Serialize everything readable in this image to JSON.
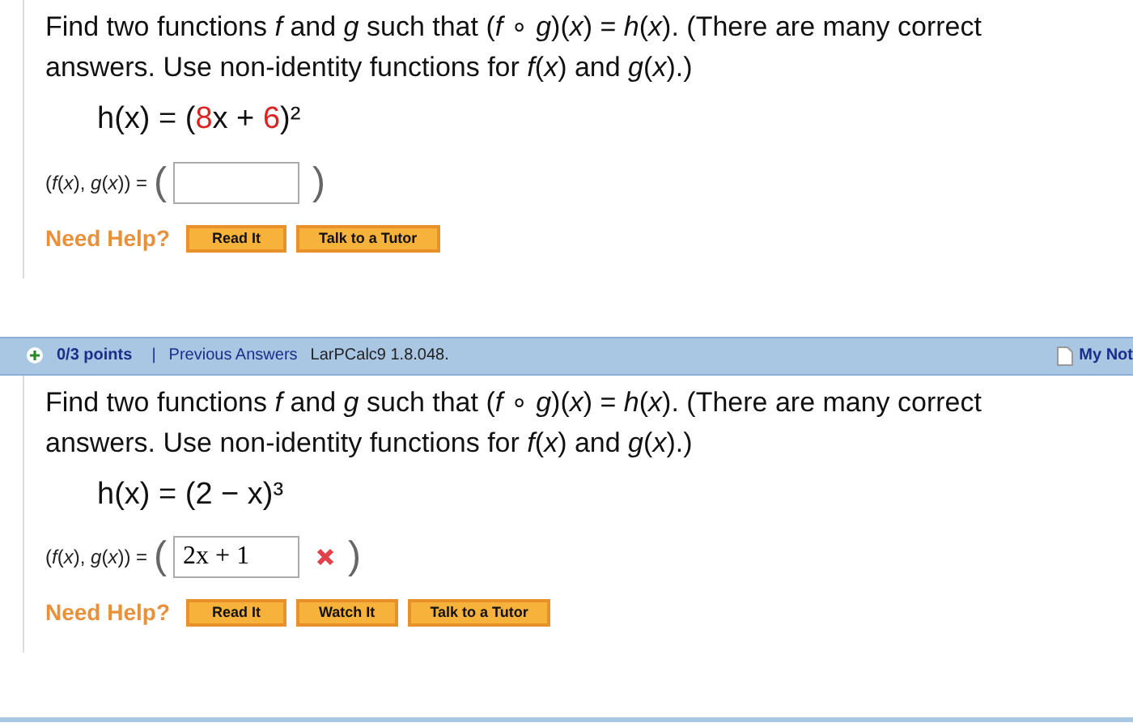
{
  "problems": [
    {
      "prompt": "Find two functions *f* and *g* such that (*f* ∘ *g*)(*x*) = *h*(*x*). (There are many correct answers. Use non-identity functions for *f*(*x*) and *g*(*x*).)",
      "equation": [
        {
          "kind": "math",
          "text": "h(x) = ("
        },
        {
          "kind": "given",
          "text": "8"
        },
        {
          "kind": "math",
          "text": "x + "
        },
        {
          "kind": "given",
          "text": "6"
        },
        {
          "kind": "math",
          "text": ")²"
        }
      ],
      "answer_label": "(*f*(*x*), *g*(*x*)) =",
      "answer": {
        "open": "(",
        "close": ")"
      },
      "help_label": "Need Help?",
      "help_buttons": [
        "Read It",
        "Talk to a Tutor"
      ]
    },
    {
      "header": {
        "points": "0/3 points",
        "separator": "|",
        "link": "Previous Answers",
        "source": "LarPCalc9 1.8.048.",
        "notes": "My Not"
      },
      "prompt": "Find two functions *f* and *g* such that (*f* ∘ *g*)(*x*) = *h*(*x*). (There are many correct answers. Use non-identity functions for *f*(*x*) and *g*(*x*).)",
      "equation": [
        {
          "kind": "math",
          "text": "h(x) = (2 − x)³"
        }
      ],
      "answer_label": "(*f*(*x*), *g*(*x*)) =",
      "answer": {
        "open": "(",
        "value": "2x + 1",
        "close": ")",
        "correct": false
      },
      "help_label": "Need Help?",
      "help_buttons": [
        "Read It",
        "Watch It",
        "Talk to a Tutor"
      ]
    }
  ]
}
